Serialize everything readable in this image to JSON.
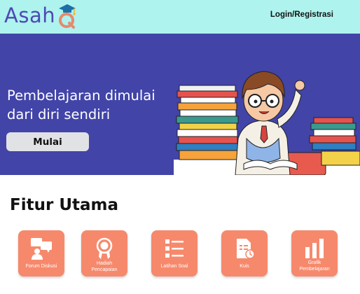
{
  "header": {
    "logo_text": "Asah",
    "logo_letter": "Q",
    "login_label": "Login/Registrasi"
  },
  "hero": {
    "title": "Pembelajaran dimulai\ndari diri sendiri",
    "button_label": "Mulai"
  },
  "features": {
    "title": "Fitur Utama",
    "items": [
      {
        "label": "Forum Diskusi",
        "icon": "forum-icon"
      },
      {
        "label": "Hadiah\nPencapaian",
        "icon": "award-icon"
      },
      {
        "label": "Latihan Soal",
        "icon": "list-icon"
      },
      {
        "label": "Kuis",
        "icon": "quiz-icon"
      },
      {
        "label": "Grafik\nPembelajaran",
        "icon": "chart-icon"
      }
    ]
  },
  "colors": {
    "header_bg": "#aef3ee",
    "brand": "#4d49b4",
    "hero_bg": "#4244a8",
    "feature_bg": "#f6896c"
  }
}
